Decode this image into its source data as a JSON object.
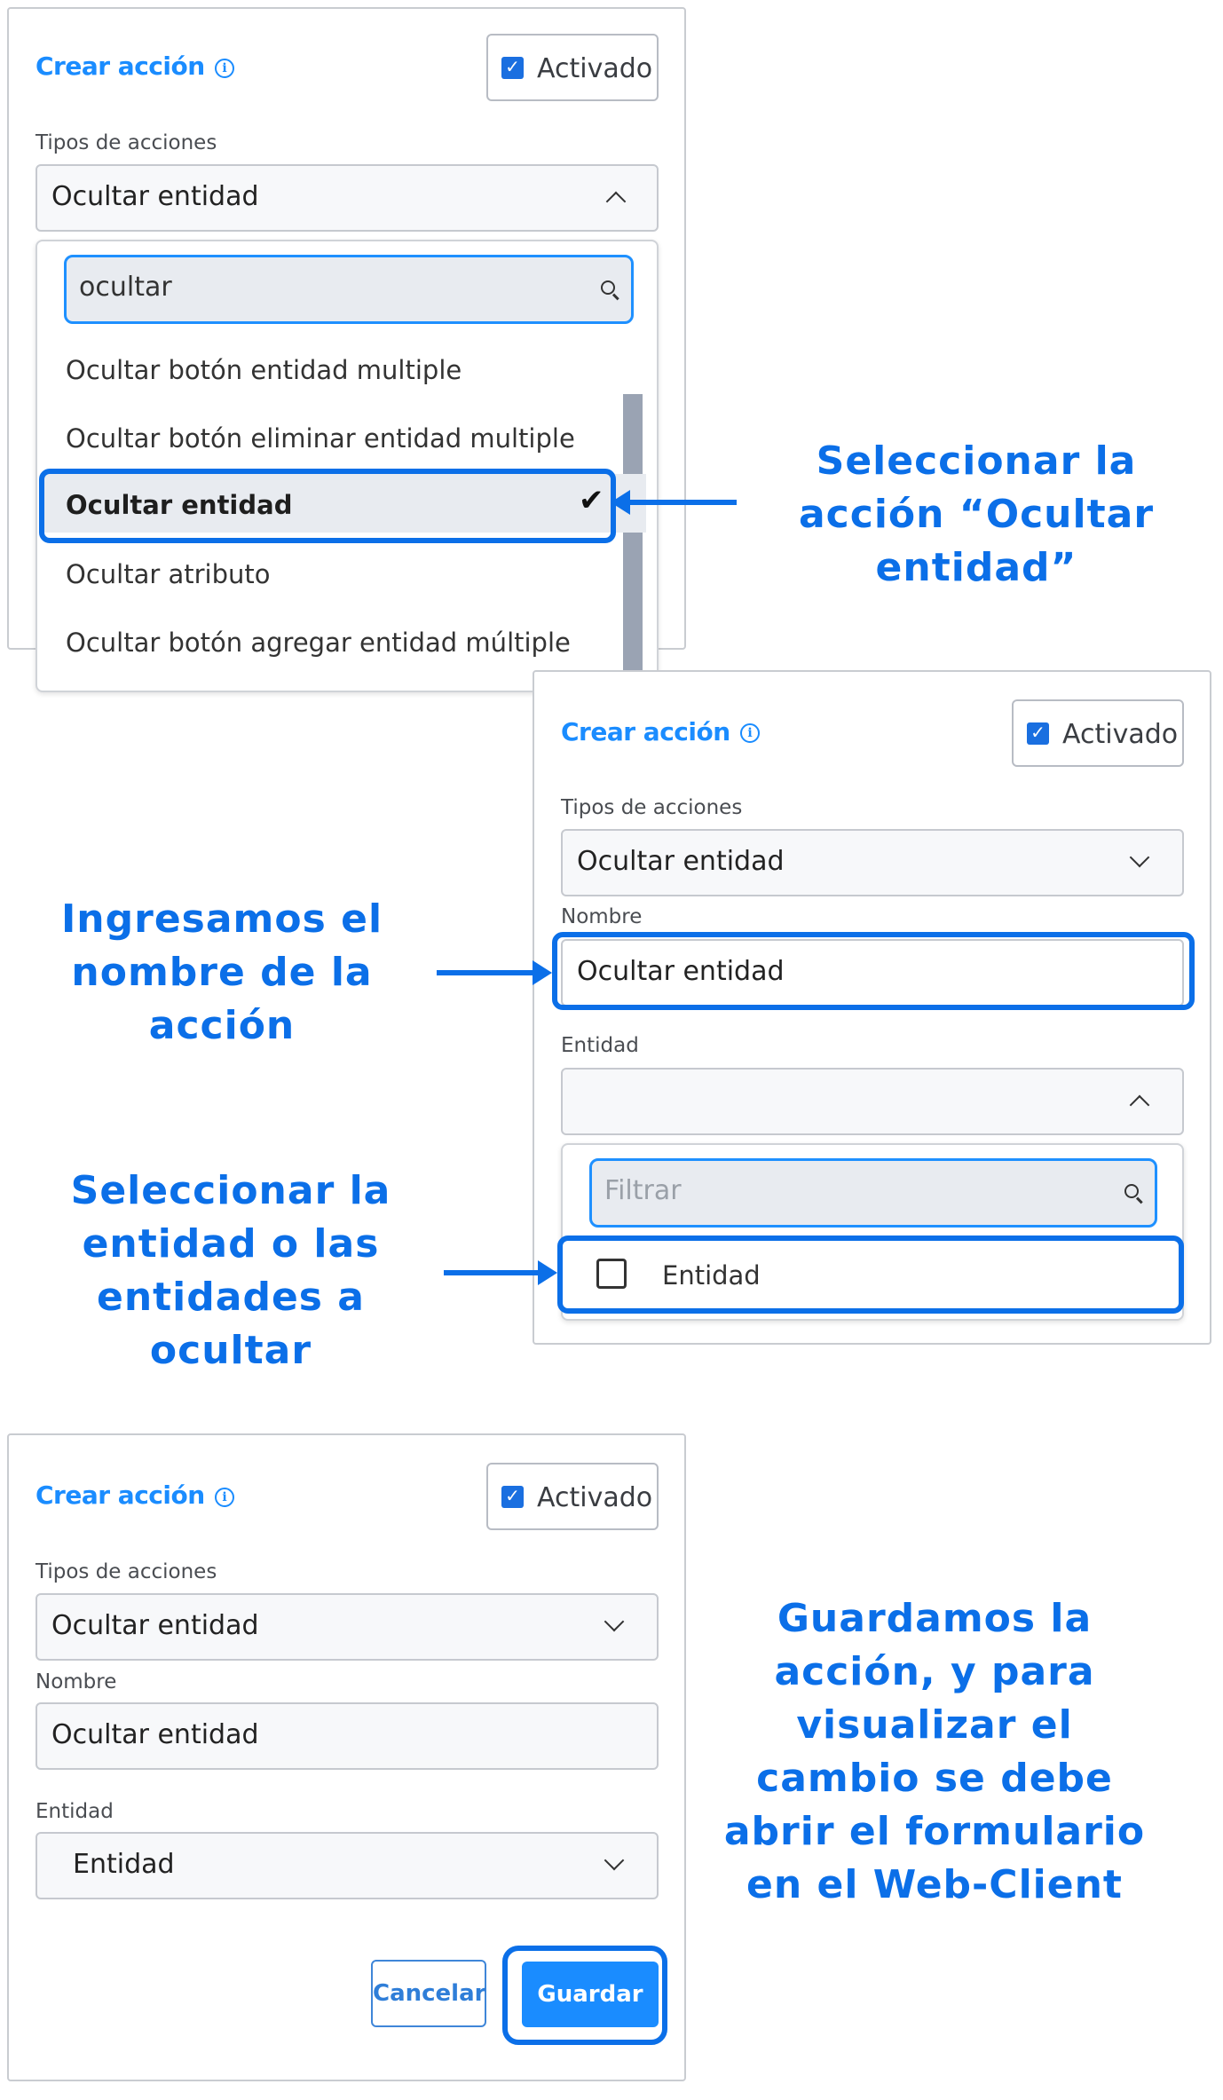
{
  "panel1": {
    "title": "Crear acción",
    "activado": "Activado",
    "tipos_label": "Tipos de acciones",
    "tipos_value": "Ocultar entidad",
    "search_value": "ocultar",
    "options": [
      "Ocultar botón entidad multiple",
      "Ocultar botón eliminar entidad multiple",
      "Ocultar entidad",
      "Ocultar atributo",
      "Ocultar botón agregar entidad múltiple"
    ],
    "selected_index": 2
  },
  "panel2": {
    "title": "Crear acción",
    "activado": "Activado",
    "tipos_label": "Tipos de acciones",
    "tipos_value": "Ocultar entidad",
    "nombre_label": "Nombre",
    "nombre_value": "Ocultar entidad",
    "entidad_label": "Entidad",
    "entidad_value": "",
    "filter_placeholder": "Filtrar",
    "entity_option": "Entidad"
  },
  "panel3": {
    "title": "Crear acción",
    "activado": "Activado",
    "tipos_label": "Tipos de acciones",
    "tipos_value": "Ocultar entidad",
    "nombre_label": "Nombre",
    "nombre_value": "Ocultar entidad",
    "entidad_label": "Entidad",
    "entidad_value": "Entidad",
    "cancel_label": "Cancelar",
    "save_label": "Guardar"
  },
  "annotations": {
    "a1": [
      "Seleccionar la",
      "acción “Ocultar",
      "entidad”"
    ],
    "a2": [
      "Ingresamos el",
      "nombre de la",
      "acción"
    ],
    "a3": [
      "Seleccionar la",
      "entidad o las",
      "entidades a",
      "ocultar"
    ],
    "a4": [
      "Guardamos la",
      "acción, y para",
      "visualizar el",
      "cambio se debe",
      "abrir el formulario",
      "en el Web-Client"
    ]
  },
  "colors": {
    "accent": "#1a8cff",
    "highlight": "#0b6fe8",
    "checkbox": "#1a6fe0"
  }
}
